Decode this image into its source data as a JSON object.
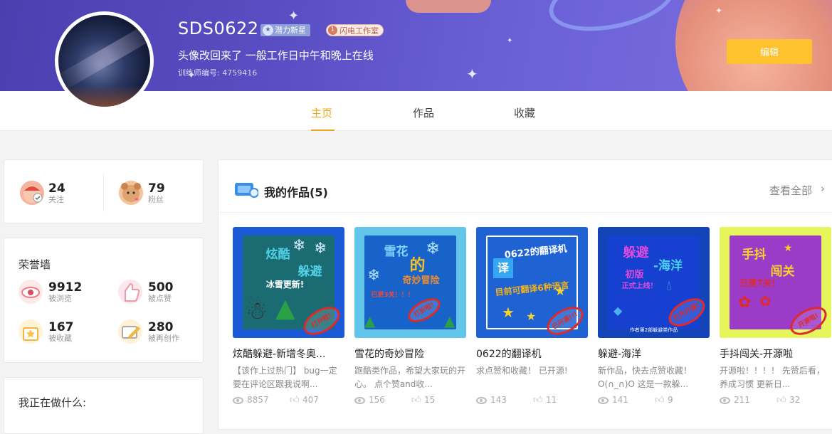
{
  "profile": {
    "username": "SDS0622",
    "badge_level": "潜力新星",
    "badge_studio_num": "1",
    "badge_studio": "闪电工作室",
    "signature": "头像改回来了 一般工作日中午和晚上在线",
    "trainer_id": "训练师编号: 4759416",
    "edit_label": "编辑"
  },
  "tabs": [
    {
      "label": "主页",
      "active": true
    },
    {
      "label": "作品",
      "active": false
    },
    {
      "label": "收藏",
      "active": false
    }
  ],
  "follow_stats": {
    "following": {
      "value": "24",
      "label": "关注"
    },
    "fans": {
      "value": "79",
      "label": "粉丝"
    }
  },
  "honor_wall": {
    "title": "荣誉墙",
    "views": {
      "value": "9912",
      "label": "被浏览"
    },
    "likes": {
      "value": "500",
      "label": "被点赞"
    },
    "collects": {
      "value": "167",
      "label": "被收藏"
    },
    "recreate": {
      "value": "280",
      "label": "被再创作"
    }
  },
  "doing": {
    "title": "我正在做什么:"
  },
  "works": {
    "title": "我的作品(5)",
    "view_all": "查看全部",
    "items": [
      {
        "name": "炫酷躲避-新增冬奥...",
        "desc": "【该作上过热门】 bug一定要在评论区跟我说啊...",
        "views": "8857",
        "likes": "407",
        "thumb_lines": [
          "炫酷",
          "躲避",
          "冰雪更新!"
        ],
        "stamp": "打开啦!",
        "bg": "#1a5ad6",
        "inner": "#1b6b73"
      },
      {
        "name": "雪花的奇妙冒险",
        "desc": "跑酷类作品，希望大家玩的开心。 点个赞and收...",
        "views": "156",
        "likes": "15",
        "thumb_lines": [
          "雪花",
          "的",
          "奇妙冒险",
          "已更3关！！！"
        ],
        "stamp": "打折啦!",
        "bg": "#62c6ea",
        "inner": "#1863c9"
      },
      {
        "name": "0622的翻译机",
        "desc": "求点赞和收藏！ 已开源!",
        "views": "143",
        "likes": "11",
        "thumb_lines": [
          "0622的翻译机",
          "译",
          "目前可翻译6种语言"
        ],
        "stamp": "已开源!!!",
        "bg": "#1e62d4",
        "inner": "#1e62d4"
      },
      {
        "name": "躲避-海洋",
        "desc": "新作品，快去点赞收藏！ O(∩_∩)O 这是一款躲...",
        "views": "141",
        "likes": "9",
        "thumb_lines": [
          "躲避",
          "-海洋",
          "初版",
          "正式上线！",
          "作者第2部躲避类作品"
        ],
        "stamp": "打开开源!",
        "bg": "#1244b8",
        "inner": "#1640d0"
      },
      {
        "name": "手抖闯关-开源啦",
        "desc": "开源啦！！！！ 先赞后看，养成习惯 更新日...",
        "views": "211",
        "likes": "32",
        "thumb_lines": [
          "手抖",
          "闯关",
          "已更7关!"
        ],
        "stamp": "开源啦!",
        "bg": "#e6f65a",
        "inner": "#9b3cc8"
      }
    ]
  },
  "colors": {
    "accent": "#f0a71a",
    "edit_button": "#fdc22d",
    "banner": "#5a4ec4"
  }
}
